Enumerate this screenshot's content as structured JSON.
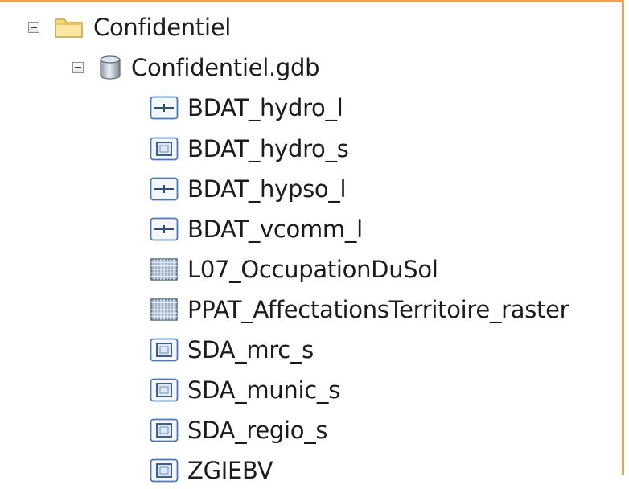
{
  "tree": {
    "folder": {
      "label": "Confidentiel",
      "icon": "folder-icon",
      "expanded": true
    },
    "geodatabase": {
      "label": "Confidentiel.gdb",
      "icon": "geodatabase-icon",
      "expanded": true
    },
    "items": [
      {
        "label": "BDAT_hydro_l",
        "icon": "line-feature-class-icon"
      },
      {
        "label": "BDAT_hydro_s",
        "icon": "polygon-feature-class-icon"
      },
      {
        "label": "BDAT_hypso_l",
        "icon": "line-feature-class-icon"
      },
      {
        "label": "BDAT_vcomm_l",
        "icon": "line-feature-class-icon"
      },
      {
        "label": "L07_OccupationDuSol",
        "icon": "raster-dataset-icon"
      },
      {
        "label": "PPAT_AffectationsTerritoire_raster",
        "icon": "raster-dataset-icon"
      },
      {
        "label": "SDA_mrc_s",
        "icon": "polygon-feature-class-icon"
      },
      {
        "label": "SDA_munic_s",
        "icon": "polygon-feature-class-icon"
      },
      {
        "label": "SDA_regio_s",
        "icon": "polygon-feature-class-icon"
      },
      {
        "label": "ZGIEBV",
        "icon": "polygon-feature-class-icon"
      }
    ]
  },
  "colors": {
    "frame_border": "#f0a24a",
    "folder_fill": "#f5d980",
    "icon_border": "#4a78b8"
  }
}
